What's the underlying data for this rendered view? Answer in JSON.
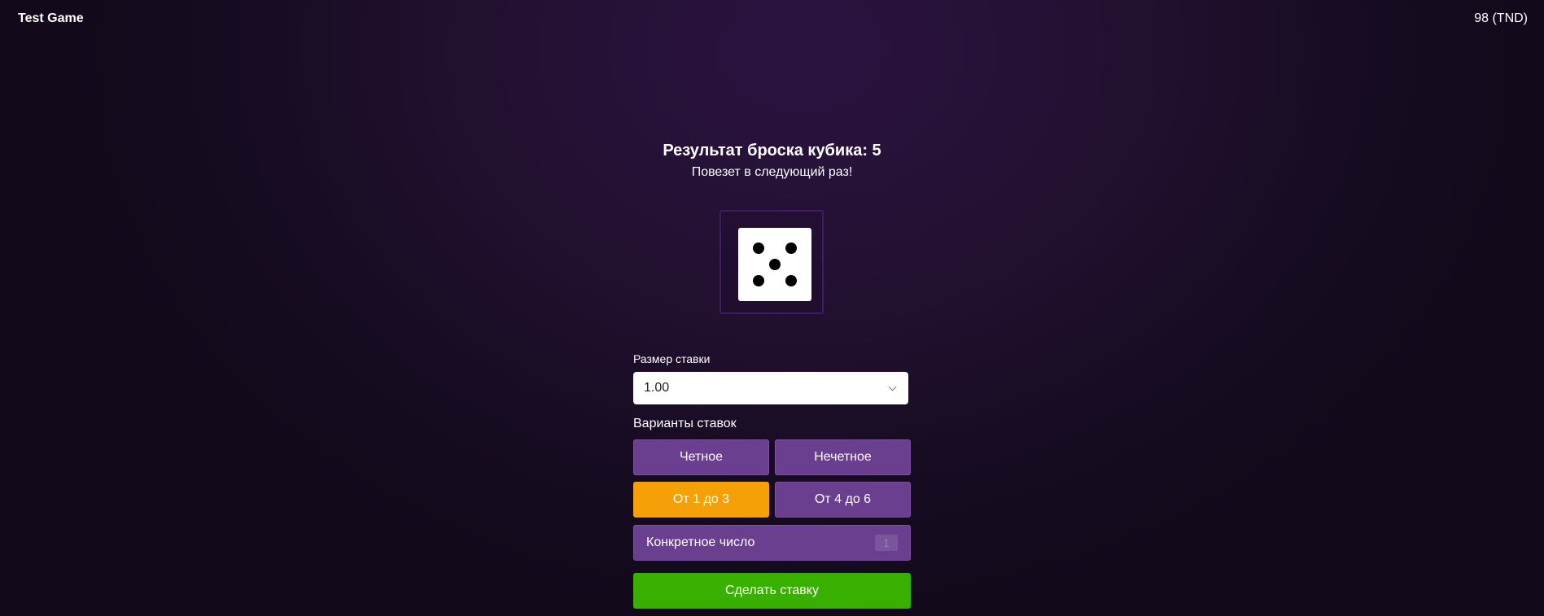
{
  "header": {
    "app_title": "Test Game",
    "balance": "98 (TND)"
  },
  "result": {
    "title": "Результат броска кубика: 5",
    "message": "Повезет в следующий раз!",
    "dice_value": 5
  },
  "bet": {
    "label": "Размер ставки",
    "selected_value": "1.00"
  },
  "options": {
    "label": "Варианты ставок",
    "even": "Четное",
    "odd": "Нечетное",
    "low_range": "От 1 до 3",
    "high_range": "От 4 до 6",
    "active": "low_range",
    "active_color": "#f5a007",
    "specific_label": "Конкретное число",
    "specific_value": "1"
  },
  "submit": {
    "label": "Сделать ставку",
    "color": "#38b000"
  }
}
